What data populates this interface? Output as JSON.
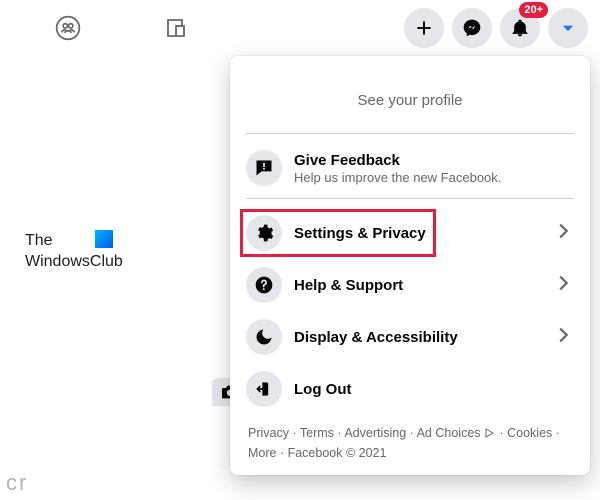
{
  "topbar": {
    "notification_badge": "20+"
  },
  "leftcol": {
    "line1": "The",
    "line2": "WindowsClub"
  },
  "menu": {
    "profile_cta": "See your profile",
    "feedback": {
      "label": "Give Feedback",
      "sub": "Help us improve the new Facebook."
    },
    "settings": {
      "label": "Settings & Privacy"
    },
    "help": {
      "label": "Help & Support"
    },
    "display": {
      "label": "Display & Accessibility"
    },
    "logout": {
      "label": "Log Out"
    }
  },
  "footer": {
    "privacy": "Privacy",
    "terms": "Terms",
    "advertising": "Advertising",
    "adchoices": "Ad Choices",
    "cookies": "Cookies",
    "more": "More",
    "copyright": "Facebook © 2021"
  },
  "corner_text": "cr"
}
